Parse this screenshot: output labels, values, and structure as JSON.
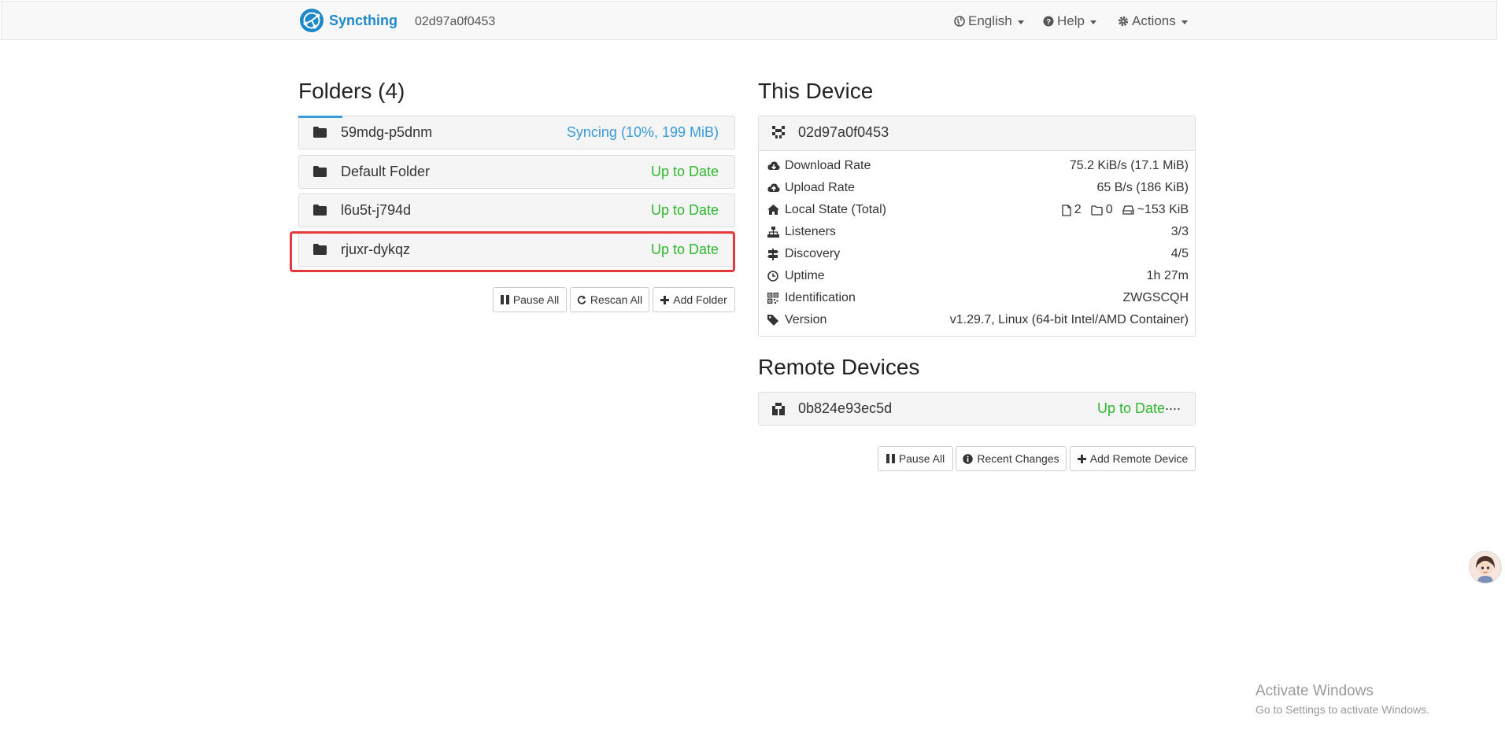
{
  "nav": {
    "brand": "Syncthing",
    "device_id": "02d97a0f0453",
    "language": "English",
    "help": "Help",
    "actions": "Actions"
  },
  "folders": {
    "heading": "Folders (4)",
    "items": [
      {
        "name": "59mdg-p5dnm",
        "status": "Syncing (10%, 199 MiB)",
        "state": "syncing"
      },
      {
        "name": "Default Folder",
        "status": "Up to Date",
        "state": "uptodate"
      },
      {
        "name": "l6u5t-j794d",
        "status": "Up to Date",
        "state": "uptodate"
      },
      {
        "name": "rjuxr-dykqz",
        "status": "Up to Date",
        "state": "uptodate"
      }
    ],
    "buttons": {
      "pause_all": "Pause All",
      "rescan_all": "Rescan All",
      "add_folder": "Add Folder"
    }
  },
  "this_device": {
    "heading": "This Device",
    "name": "02d97a0f0453",
    "rows": {
      "download_label": "Download Rate",
      "download_value": "75.2 KiB/s (17.1 MiB)",
      "upload_label": "Upload Rate",
      "upload_value": "65 B/s (186 KiB)",
      "local_label": "Local State (Total)",
      "local_files": "2",
      "local_dirs": "0",
      "local_size": "~153 KiB",
      "listeners_label": "Listeners",
      "listeners_value": "3/3",
      "discovery_label": "Discovery",
      "discovery_value": "4/5",
      "uptime_label": "Uptime",
      "uptime_value": "1h 27m",
      "ident_label": "Identification",
      "ident_value": "ZWGSCQH",
      "version_label": "Version",
      "version_value": "v1.29.7, Linux (64-bit Intel/AMD Container)"
    }
  },
  "remote": {
    "heading": "Remote Devices",
    "device_name": "0b824e93ec5d",
    "device_status": "Up to Date",
    "more": "....",
    "buttons": {
      "pause_all": "Pause All",
      "recent_changes": "Recent Changes",
      "add_remote": "Add Remote Device"
    }
  },
  "watermark": {
    "line1": "Activate Windows",
    "line2": "Go to Settings to activate Windows."
  },
  "colors": {
    "accent": "#3a9ad9",
    "success": "#2eb82e",
    "brand": "#1e89c9",
    "highlight": "#e5393d"
  }
}
